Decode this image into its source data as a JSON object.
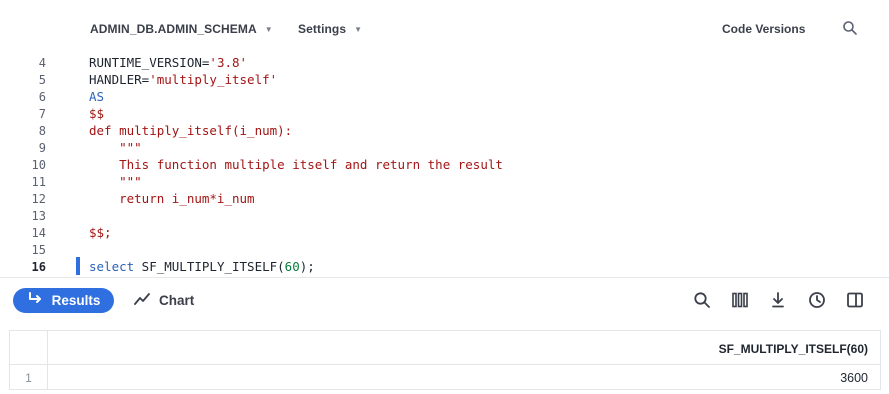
{
  "toolbar": {
    "database_schema": "ADMIN_DB.ADMIN_SCHEMA",
    "settings_label": "Settings",
    "code_versions_label": "Code Versions"
  },
  "editor": {
    "lines": [
      {
        "num": "4",
        "text_a": "RUNTIME_VERSION=",
        "text_b": "'3.8'"
      },
      {
        "num": "5",
        "text_a": "HANDLER=",
        "text_b": "'multiply_itself'"
      },
      {
        "num": "6",
        "text": "AS"
      },
      {
        "num": "7",
        "text": "$$"
      },
      {
        "num": "8",
        "text": "def multiply_itself(i_num):"
      },
      {
        "num": "9",
        "text": "    \"\"\""
      },
      {
        "num": "10",
        "text": "    This function multiple itself and return the result"
      },
      {
        "num": "11",
        "text": "    \"\"\""
      },
      {
        "num": "12",
        "text": "    return i_num*i_num"
      },
      {
        "num": "13",
        "text": ""
      },
      {
        "num": "14",
        "text": "$$;"
      },
      {
        "num": "15",
        "text": ""
      },
      {
        "num": "16",
        "kw": "select",
        "fn": " SF_MULTIPLY_ITSELF(",
        "arg": "60",
        "end": ");"
      }
    ]
  },
  "results_bar": {
    "results_label": "Results",
    "chart_label": "Chart"
  },
  "results_table": {
    "column_header": "SF_MULTIPLY_ITSELF(60)",
    "rows": [
      {
        "row_number": "1",
        "value": "3600"
      }
    ]
  },
  "colors": {
    "accent": "#2f6fe0",
    "string": "#a31515",
    "keyword": "#2b62b8",
    "number": "#0b7a3e"
  }
}
